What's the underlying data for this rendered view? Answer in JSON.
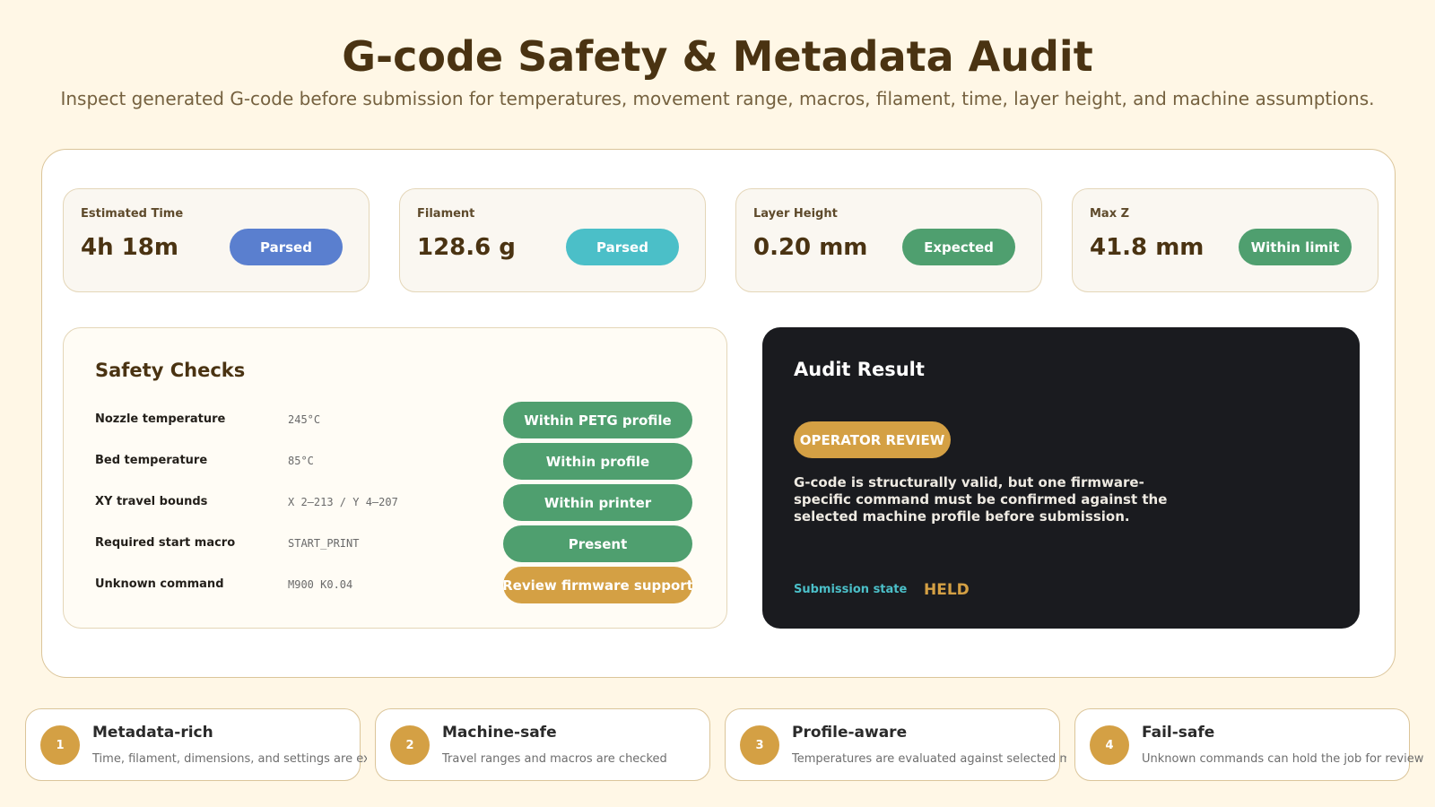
{
  "header": {
    "title": "G-code Safety & Metadata Audit",
    "subtitle": "Inspect generated G-code before submission for temperatures, movement range, macros, filament, time, layer height, and machine assumptions."
  },
  "metrics": [
    {
      "label": "Estimated Time",
      "value": "4h 18m",
      "badge": "Parsed",
      "color": "#5a7fcf"
    },
    {
      "label": "Filament",
      "value": "128.6 g",
      "badge": "Parsed",
      "color": "#4bbfc8"
    },
    {
      "label": "Layer Height",
      "value": "0.20 mm",
      "badge": "Expected",
      "color": "#4f9f6f"
    },
    {
      "label": "Max Z",
      "value": "41.8 mm",
      "badge": "Within limit",
      "color": "#4f9f6f"
    }
  ],
  "safety": {
    "title": "Safety Checks",
    "checks": [
      {
        "label": "Nozzle temperature",
        "value": "245°C",
        "status": "Within PETG profile",
        "color": "#4f9f6f"
      },
      {
        "label": "Bed temperature",
        "value": "85°C",
        "status": "Within profile",
        "color": "#4f9f6f"
      },
      {
        "label": "XY travel bounds",
        "value": "X 2–213 / Y 4–207",
        "status": "Within printer",
        "color": "#4f9f6f"
      },
      {
        "label": "Required start macro",
        "value": "START_PRINT",
        "status": "Present",
        "color": "#4f9f6f"
      },
      {
        "label": "Unknown command",
        "value": "M900 K0.04",
        "status": "Review firmware support",
        "color": "#d4a044"
      }
    ]
  },
  "result": {
    "title": "Audit Result",
    "badge": "OPERATOR REVIEW",
    "text": "G-code is structurally valid, but one firmware-specific command must be confirmed against the selected machine profile before submission.",
    "state_label": "Submission state",
    "state_value": "HELD"
  },
  "features": [
    {
      "num": "1",
      "title": "Metadata-rich",
      "desc": "Time, filament, dimensions, and settings are extracted"
    },
    {
      "num": "2",
      "title": "Machine-safe",
      "desc": "Travel ranges and macros are checked"
    },
    {
      "num": "3",
      "title": "Profile-aware",
      "desc": "Temperatures are evaluated against selected materials"
    },
    {
      "num": "4",
      "title": "Fail-safe",
      "desc": "Unknown commands can hold the job for review"
    }
  ]
}
